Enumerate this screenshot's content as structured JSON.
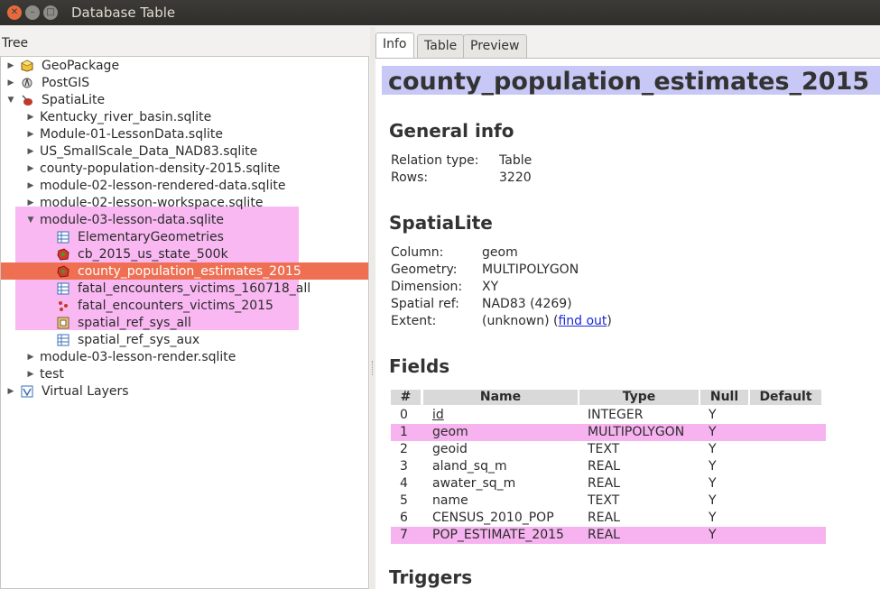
{
  "window": {
    "title": "Database  Table"
  },
  "tree": {
    "label": "Tree",
    "rows": [
      {
        "label": "GeoPackage",
        "icon": "geopackage-icon",
        "level": 0,
        "arrow": "▶"
      },
      {
        "label": "PostGIS",
        "icon": "postgis-icon",
        "level": 0,
        "arrow": "▶"
      },
      {
        "label": "SpatiaLite",
        "icon": "spatialite-icon",
        "level": 0,
        "arrow": "▼"
      },
      {
        "label": "Kentucky_river_basin.sqlite",
        "level": 1,
        "arrow": "▶"
      },
      {
        "label": "Module-01-LessonData.sqlite",
        "level": 1,
        "arrow": "▶"
      },
      {
        "label": "US_SmallScale_Data_NAD83.sqlite",
        "level": 1,
        "arrow": "▶"
      },
      {
        "label": "county-population-density-2015.sqlite",
        "level": 1,
        "arrow": "▶"
      },
      {
        "label": "module-02-lesson-rendered-data.sqlite",
        "level": 1,
        "arrow": "▶"
      },
      {
        "label": "module-02-lesson-workspace.sqlite",
        "level": 1,
        "arrow": "▶"
      },
      {
        "label": "module-03-lesson-data.sqlite",
        "level": 1,
        "arrow": "▼"
      },
      {
        "label": "ElementaryGeometries",
        "icon": "table-icon",
        "level": 2
      },
      {
        "label": "cb_2015_us_state_500k",
        "icon": "polygon-layer-icon",
        "level": 2
      },
      {
        "label": "county_population_estimates_2015",
        "icon": "polygon-layer-icon",
        "level": 2,
        "selected": true
      },
      {
        "label": "fatal_encounters_victims_160718_all",
        "icon": "table-icon",
        "level": 2
      },
      {
        "label": "fatal_encounters_victims_2015",
        "icon": "point-layer-icon",
        "level": 2
      },
      {
        "label": "spatial_ref_sys_all",
        "icon": "view-icon",
        "level": 2
      },
      {
        "label": "spatial_ref_sys_aux",
        "icon": "table-icon",
        "level": 2
      },
      {
        "label": "module-03-lesson-render.sqlite",
        "level": 1,
        "arrow": "▶"
      },
      {
        "label": "test",
        "level": 1,
        "arrow": "▶"
      },
      {
        "label": "Virtual Layers",
        "icon": "virtual-layers-icon",
        "level": 0,
        "arrow": "▶"
      }
    ]
  },
  "tabs": [
    {
      "label": "Info",
      "active": true
    },
    {
      "label": "Table",
      "active": false
    },
    {
      "label": "Preview",
      "active": false
    }
  ],
  "info": {
    "title": "county_population_estimates_2015",
    "general": {
      "heading": "General info",
      "relation_type_label": "Relation type:",
      "relation_type": "Table",
      "rows_label": "Rows:",
      "rows": "3220"
    },
    "spatialite": {
      "heading": "SpatiaLite",
      "column_label": "Column:",
      "column": "geom",
      "geometry_label": "Geometry:",
      "geometry": "MULTIPOLYGON",
      "dimension_label": "Dimension:",
      "dimension": "XY",
      "spatial_ref_label": "Spatial ref:",
      "spatial_ref": "NAD83 (4269)",
      "extent_label": "Extent:",
      "extent": "(unknown) (",
      "find_out": "find out",
      "extent_close": ")"
    },
    "fields": {
      "heading": "Fields",
      "columns": [
        "#",
        "Name",
        "Type",
        "Null",
        "Default"
      ],
      "rows": [
        {
          "num": "0",
          "name": "id",
          "type": "INTEGER",
          "null": "Y",
          "default": "",
          "highlight": false
        },
        {
          "num": "1",
          "name": "geom",
          "type": "MULTIPOLYGON",
          "null": "Y",
          "default": "",
          "highlight": true
        },
        {
          "num": "2",
          "name": "geoid",
          "type": "TEXT",
          "null": "Y",
          "default": "",
          "highlight": false
        },
        {
          "num": "3",
          "name": "aland_sq_m",
          "type": "REAL",
          "null": "Y",
          "default": "",
          "highlight": false
        },
        {
          "num": "4",
          "name": "awater_sq_m",
          "type": "REAL",
          "null": "Y",
          "default": "",
          "highlight": false
        },
        {
          "num": "5",
          "name": "name",
          "type": "TEXT",
          "null": "Y",
          "default": "",
          "highlight": false
        },
        {
          "num": "6",
          "name": "CENSUS_2010_POP",
          "type": "REAL",
          "null": "Y",
          "default": "",
          "highlight": false
        },
        {
          "num": "7",
          "name": "POP_ESTIMATE_2015",
          "type": "REAL",
          "null": "Y",
          "default": "",
          "highlight": true
        }
      ]
    },
    "triggers": {
      "heading": "Triggers"
    }
  },
  "colors": {
    "title_bg": "#c8c8f6",
    "highlight_pink": "#f9b8f2",
    "selection": "#ef6f52",
    "link": "#1a2ad6"
  }
}
